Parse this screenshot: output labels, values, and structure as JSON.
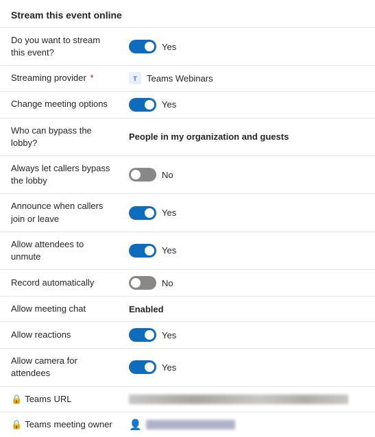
{
  "page": {
    "title": "Stream this event online"
  },
  "rows": [
    {
      "id": "stream-event",
      "label": "Do you want to stream this event?",
      "type": "toggle",
      "state": "on",
      "value_label": "Yes"
    },
    {
      "id": "streaming-provider",
      "label": "Streaming provider",
      "required": true,
      "type": "provider",
      "value_label": "Teams Webinars"
    },
    {
      "id": "change-meeting-options",
      "label": "Change meeting options",
      "type": "toggle",
      "state": "on",
      "value_label": "Yes"
    },
    {
      "id": "bypass-lobby",
      "label": "Who can bypass the lobby?",
      "type": "bold",
      "value_label": "People in my organization and guests"
    },
    {
      "id": "callers-bypass-lobby",
      "label": "Always let callers bypass the lobby",
      "type": "toggle",
      "state": "off",
      "value_label": "No"
    },
    {
      "id": "announce-callers",
      "label": "Announce when callers join or leave",
      "type": "toggle",
      "state": "on",
      "value_label": "Yes"
    },
    {
      "id": "allow-unmute",
      "label": "Allow attendees to unmute",
      "type": "toggle",
      "state": "on",
      "value_label": "Yes"
    },
    {
      "id": "record-automatically",
      "label": "Record automatically",
      "type": "toggle",
      "state": "off",
      "value_label": "No"
    },
    {
      "id": "meeting-chat",
      "label": "Allow meeting chat",
      "type": "bold",
      "value_label": "Enabled"
    },
    {
      "id": "allow-reactions",
      "label": "Allow reactions",
      "type": "toggle",
      "state": "on",
      "value_label": "Yes"
    },
    {
      "id": "allow-camera",
      "label": "Allow camera for attendees",
      "type": "toggle",
      "state": "on",
      "value_label": "Yes"
    },
    {
      "id": "teams-url",
      "label": "Teams URL",
      "type": "url",
      "has_lock": true
    },
    {
      "id": "teams-meeting-owner",
      "label": "Teams meeting owner",
      "type": "owner",
      "has_lock": true
    }
  ],
  "labels": {
    "yes": "Yes",
    "no": "No",
    "teams_webinars": "Teams Webinars",
    "lobby_value": "People in my organization and guests",
    "chat_value": "Enabled",
    "teams_label": "Teams"
  }
}
